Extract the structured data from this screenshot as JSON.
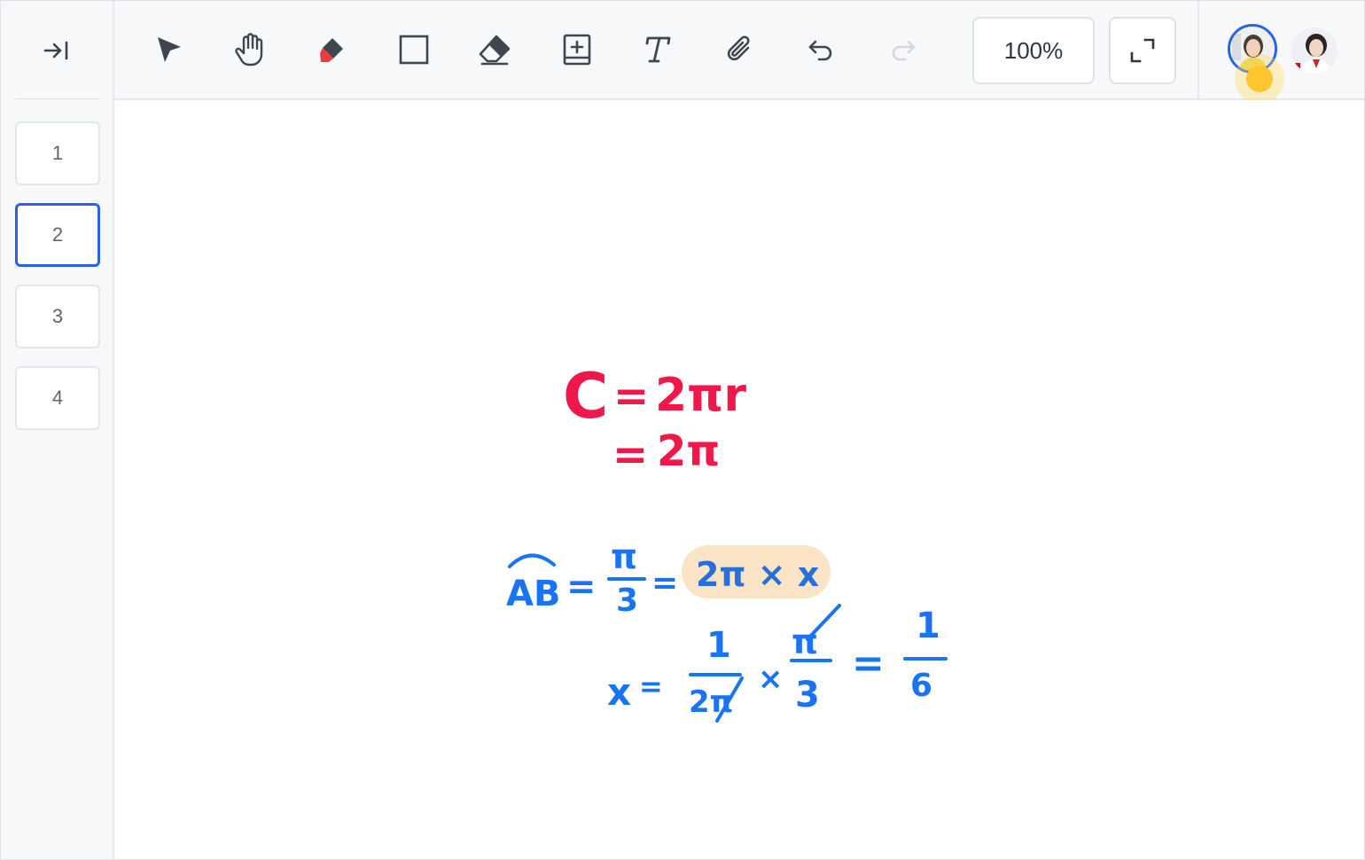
{
  "sidebar": {
    "collapse_icon": "collapse-right-icon",
    "pages": [
      {
        "label": "1",
        "active": false
      },
      {
        "label": "2",
        "active": true
      },
      {
        "label": "3",
        "active": false
      },
      {
        "label": "4",
        "active": false
      }
    ]
  },
  "toolbar": {
    "tools": [
      "select-arrow-icon",
      "hand-pan-icon",
      "marker-icon",
      "rectangle-icon",
      "eraser-icon",
      "add-page-icon",
      "text-icon",
      "attachment-icon",
      "undo-icon",
      "redo-icon"
    ],
    "zoom_label": "100%",
    "expand_icon": "fullscreen-icon"
  },
  "participants": {
    "active_speaker_indicator": "speaking-dot-icon"
  },
  "whiteboard": {
    "red_line_1": {
      "c": "C",
      "eq": "=",
      "rhs": "2πr"
    },
    "red_line_2": {
      "eq": "=",
      "rhs": "2π"
    },
    "blue_line_1": {
      "lhs": "AB",
      "eq1": "=",
      "num": "π",
      "den": "3",
      "eq2": "=",
      "highlighted": "2π × x"
    },
    "blue_line_2": {
      "lhs": "x",
      "eq": "=",
      "f1_num": "1",
      "f1_den": "2π",
      "times": "×",
      "f2_num": "π",
      "f2_den": "3",
      "eq2": "=",
      "res_num": "1",
      "res_den": "6"
    },
    "colors": {
      "red_ink": "#f0174a",
      "blue_ink": "#1a73f0",
      "highlight": "#fbe3c6",
      "accent": "#2563eb"
    }
  }
}
